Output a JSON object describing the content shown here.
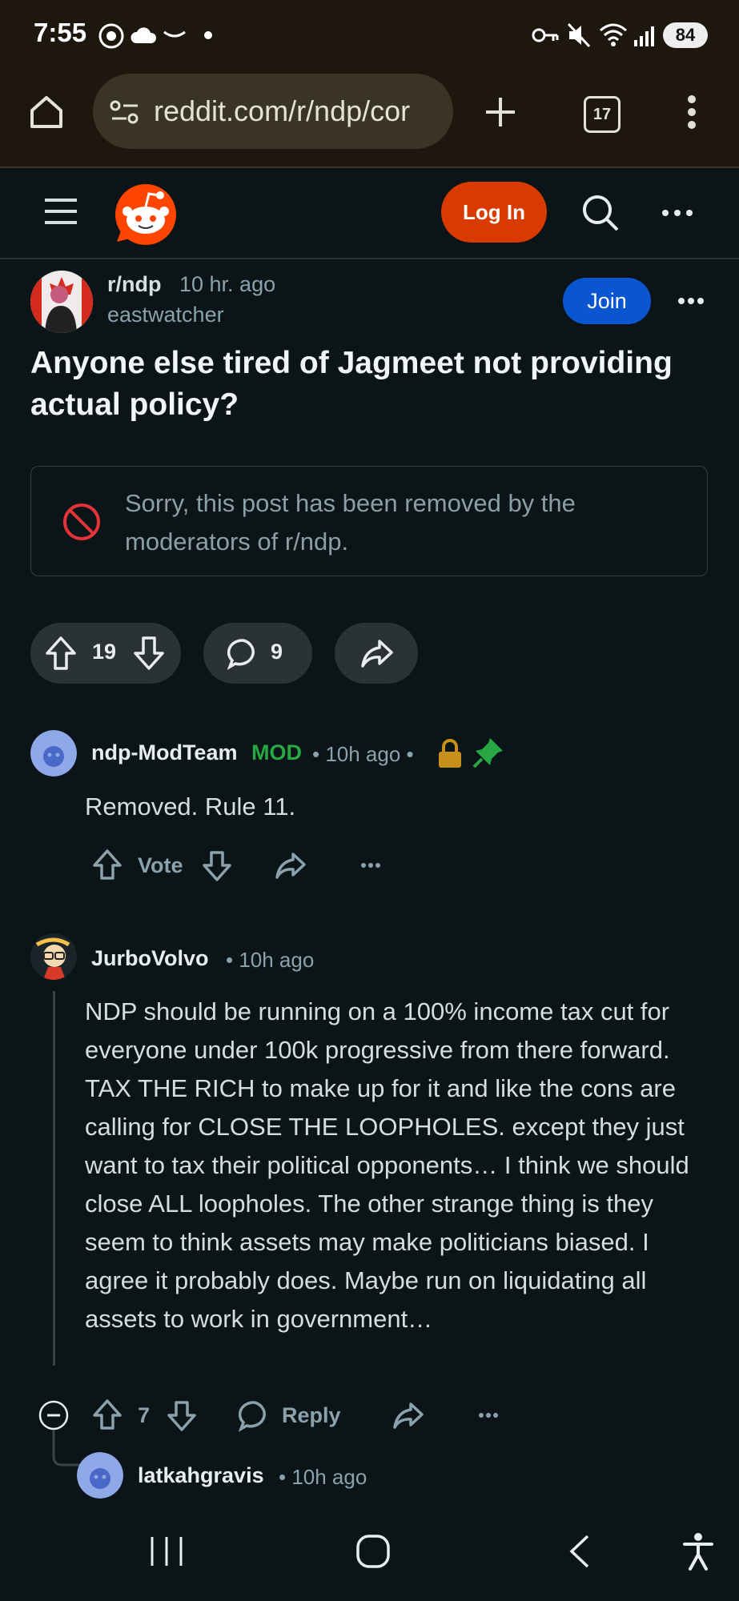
{
  "status_bar": {
    "time": "7:55",
    "battery": "84"
  },
  "browser": {
    "url": "reddit.com/r/ndp/cor",
    "tab_count": "17"
  },
  "header": {
    "login_label": "Log In"
  },
  "post": {
    "subreddit": "r/ndp",
    "age": "10 hr. ago",
    "author": "eastwatcher",
    "join_label": "Join",
    "title": "Anyone else tired of Jagmeet not providing actual policy?",
    "removed_notice": "Sorry, this post has been removed by the moderators of r/ndp.",
    "score": "19",
    "comment_count": "9"
  },
  "comments": [
    {
      "user": "ndp-ModTeam",
      "tag": "MOD",
      "meta": "• 10h ago •",
      "body": "Removed. Rule 11.",
      "vote_label": "Vote"
    },
    {
      "user": "JurboVolvo",
      "meta": "• 10h ago",
      "body": "NDP should be running on a 100% income tax cut for everyone under 100k progressive from there forward. TAX THE RICH to make up for it and like the cons are calling for CLOSE THE LOOPHOLES. except they just want to tax their political opponents… I think we should close ALL loopholes. The other strange thing is they seem to think assets may make politicians biased. I agree it probably does. Maybe run on liquidating all assets to work in government…",
      "score": "7",
      "reply_label": "Reply"
    },
    {
      "user": "latkahgravis",
      "meta": "• 10h ago"
    }
  ],
  "colors": {
    "reddit_orange": "#d93a00",
    "join_blue": "#0a56d0",
    "mod_green": "#28a745",
    "lock_gold": "#c8901a"
  }
}
